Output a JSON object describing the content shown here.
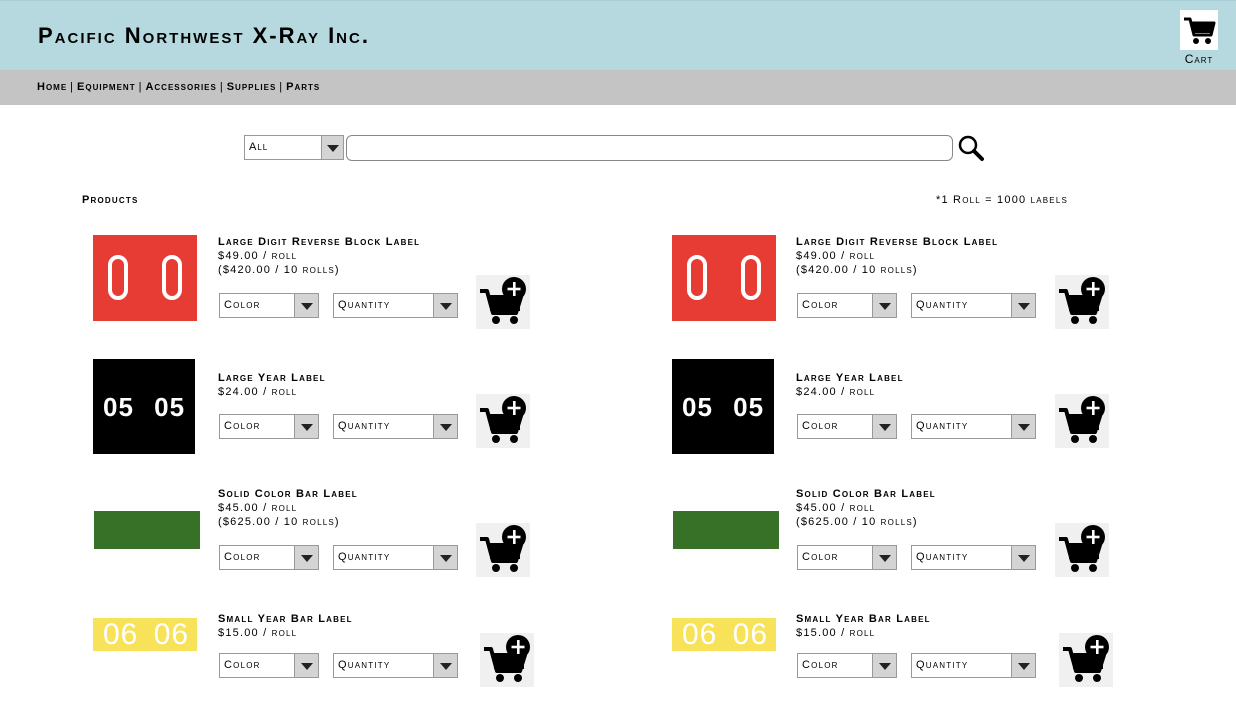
{
  "header": {
    "title": "Pacific Northwest X-Ray Inc.",
    "cart_label": "Cart"
  },
  "nav": {
    "items": [
      "Home",
      "Equipment",
      "Accessories",
      "Supplies",
      "Parts"
    ],
    "separator": "|"
  },
  "search": {
    "category_value": "All",
    "query_value": ""
  },
  "products_heading": "Products",
  "roll_note": "*1 Roll = 1000 labels",
  "products": [
    {
      "name": "Large Digit Reverse Block Label",
      "price": "$49.00 / roll",
      "bulk_price": "($420.00 / 10 rolls)",
      "thumb_text": "0 0",
      "color_placeholder": "Color",
      "quantity_placeholder": "Quantity"
    },
    {
      "name": "Large Year Label",
      "price": "$24.00 / roll",
      "bulk_price": "",
      "thumb_text": "05 05",
      "color_placeholder": "Color",
      "quantity_placeholder": "Quantity"
    },
    {
      "name": "Solid Color Bar Label",
      "price": "$45.00 / roll",
      "bulk_price": "($625.00 / 10 rolls)",
      "thumb_text": "",
      "color_placeholder": "Color",
      "quantity_placeholder": "Quantity"
    },
    {
      "name": "Small Year Bar Label",
      "price": "$15.00 / roll",
      "bulk_price": "",
      "thumb_text": "06 06",
      "color_placeholder": "Color",
      "quantity_placeholder": "Quantity"
    }
  ],
  "colors": {
    "header_bg": "#b5d9de",
    "nav_bg": "#c4c4c4",
    "red_label": "#e73c33",
    "black_label": "#000000",
    "green_label": "#377128",
    "yellow_label": "#f7e25a"
  },
  "icons": {
    "cart": "cart-icon",
    "add_to_cart": "add-to-cart-icon",
    "search": "magnifier-icon",
    "dropdown": "triangle-down-icon"
  }
}
